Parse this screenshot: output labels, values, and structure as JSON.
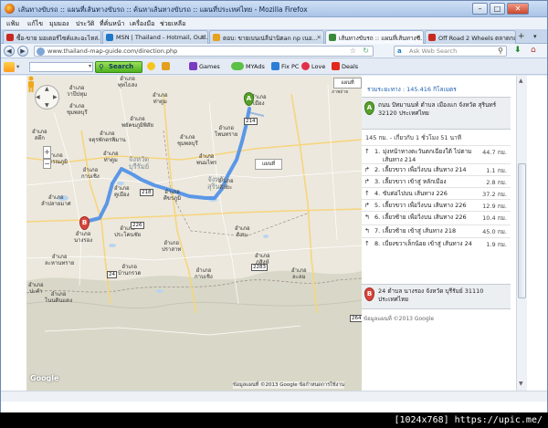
{
  "window": {
    "title": "เส้นทางขับรถ :: แผนที่เส้นทางขับรถ :: ค้นหาเส้นทางขับรถ :: แผนที่ประเทศไทย - Mozilla Firefox",
    "min": "–",
    "max": "□",
    "close": "✕"
  },
  "menu": [
    "แฟ้ม",
    "แก้ไข",
    "มุมมอง",
    "ประวัติ",
    "ที่คั่นหน้า",
    "เครื่องมือ",
    "ช่วยเหลือ"
  ],
  "tabs": [
    {
      "label": "ซื้อ-ขาย มอเตอร์ไซค์และอะไหล่...",
      "color": "#c8281e"
    },
    {
      "label": "MSN | Thailand - Hotmail, Outl...",
      "color": "#1e78c8"
    },
    {
      "label": "ตอบ: ขายเบนเน่ลีน่านิตan np เนอ...",
      "color": "#e5a21a"
    },
    {
      "label": "เส้นทางขับรถ :: แผนที่เส้นทางขั...",
      "color": "#3a8a3a"
    },
    {
      "label": "Off Road 2 Wheels ตลาดกลาง ต่า...",
      "color": "#c8281e"
    }
  ],
  "nav": {
    "url": "www.thailand-map-guide.com/direction.php",
    "search_placeholder": "Ask Web Search"
  },
  "toolbar": {
    "search_label": "Search",
    "items": [
      "Games",
      "MY",
      "Ads",
      "Fix PC",
      "Love",
      "Deals"
    ]
  },
  "map": {
    "map_type": "แผนที่",
    "map_type_alt": "ภาพถ่าย",
    "map_type2": "แผนที่",
    "copyright": "ข้อมูลแผนที่ ©2013 Google",
    "terms": "ข้อกำหนดการใช้งาน",
    "google": "Google",
    "pin_a": "A",
    "pin_b": "B",
    "labels": [
      "อำเภอ\nวาปีปทุม",
      "อำเภอ\nชุมพลบุรี",
      "อำเภอ\nท่าตูม",
      "อำเภอ\nพยัคฆภูมิพิสัย",
      "อำเภอ\nจตุรพักตรพิมาน",
      "อำเภอ\nเมือง",
      "อำเภอ\nสุวรรณภูมิ",
      "อำเภอ\nท่าตูม",
      "อำเภอ\nชุมพลบุรี",
      "อำเภอ\nโพนทราย",
      "อำเภอ\nพนมไพร",
      "อำเภอ\nกาบเชิง",
      "อำเภอ\nคูเมือง",
      "อำเภอ\nสังขะ",
      "อำเภอ\nศีขรภูมิ",
      "อำเภอ\nปราสาท",
      "อำเภอ\nนางรอง",
      "อำเภอ\nประโคนชัย",
      "อำเภอ\nละหานทราย",
      "อำเภอ\nบ้านกรวด",
      "อำเภอ\nโนนดินแดง",
      "อำเภอ\nปะคำ",
      "อำเภอ\nสังขะ",
      "อำเภอ\nกาบเชิง",
      "อำเภอ\nภูสิงห์",
      "อำเภอ\nลำปลายมาศ",
      "อำเภอ\nพุทไธสง",
      "อำเภอ\nละลม",
      "อำเภอ\nสตึก"
    ],
    "provinces": [
      "จังหวัด\nบุรีรัมย์",
      "จังหวัด\nสุรินทร์"
    ],
    "highways": [
      "214",
      "226",
      "24",
      "218",
      "2283",
      "2648"
    ]
  },
  "directions": {
    "total": "รวมระยะทาง : 145.416 กิโลเมตร",
    "start": "ถนน ปัทมานนท์ ตำบล เมืองแก จังหวัด สุรินทร์ 32120 ประเทศไทย",
    "summary": "145 กม. - เกี่ยวกับ 1 ชั่วโมง 51 นาที",
    "steps": [
      {
        "num": "1.",
        "icon": "↑",
        "text": "มุ่งหน้าทางตะวันตกเฉียงใต้ ไปตามเส้นทาง 214",
        "dist": "44.7 กม."
      },
      {
        "num": "2.",
        "icon": "↱",
        "text": "เลี้ยวขวา เพื่อวิ่งบน เส้นทาง 214",
        "dist": "1.1 กม."
      },
      {
        "num": "3.",
        "icon": "↱",
        "text": "เลี้ยวขวา เข้าสู่ หลักเมือง",
        "dist": "2.8 กม."
      },
      {
        "num": "4.",
        "icon": "↑",
        "text": "ขับต่อไปบน เส้นทาง 226",
        "dist": "37.2 กม."
      },
      {
        "num": "5.",
        "icon": "↱",
        "text": "เลี้ยวขวา เพื่อวิ่งบน เส้นทาง 226",
        "dist": "12.9 กม."
      },
      {
        "num": "6.",
        "icon": "↰",
        "text": "เลี้ยวซ้าย เพื่อวิ่งบน เส้นทาง 226",
        "dist": "10.4 กม."
      },
      {
        "num": "7.",
        "icon": "↰",
        "text": "เลี้ยวซ้าย เข้าสู่ เส้นทาง 218",
        "dist": "45.0 กม."
      },
      {
        "num": "8.",
        "icon": "↑",
        "text": "เบี่ยงขวาเล็กน้อย เข้าสู่ เส้นทาง 24",
        "dist": "1.9 กม."
      }
    ],
    "end": "24 ตำบล นางรอง จังหวัด บุรีรัมย์ 31110 ประเทศไทย",
    "copyright": "ข้อมูลแผนที่ ©2013 Google"
  },
  "caption": "[1024x768] https://upic.me/"
}
